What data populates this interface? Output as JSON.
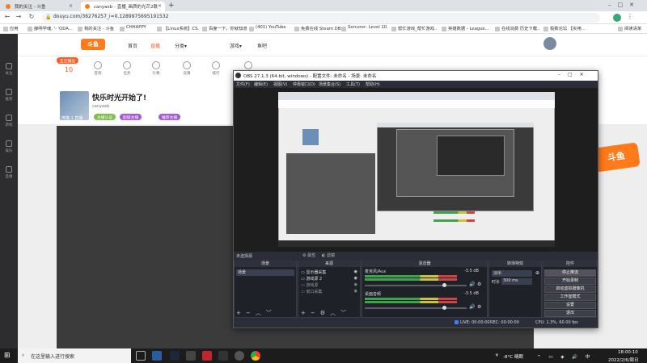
{
  "browser": {
    "tabs": [
      {
        "title": "我的关注 - 斗鱼",
        "active": false
      },
      {
        "title": "canyaxb - 直播_画质的光芒2联",
        "active": true
      }
    ],
    "new_tab": "+",
    "url": "douyu.com/36276257_i=0.1289975695191532",
    "bookmarks": [
      "应用",
      "薛明学魂, '- 'ODA...",
      "我的关注 - 斗鱼",
      "CHHAPPY",
      "【Linux系统】CS...",
      "百度一下，你就知道",
      "(401) YouTube",
      "免费在线 Steam DB",
      "Sorcerer: Level 10...",
      "帮忙游戏_帮忙游戏...",
      "英雄数据 - League...",
      "在线消费 历史下载...",
      "极致论坛 【实用...",
      "阅读清单"
    ]
  },
  "douyu": {
    "sidebar": [
      "关注",
      "推荐",
      "游戏",
      "娱乐",
      "直播"
    ],
    "logo": "斗鱼",
    "nav": [
      "首页",
      "直播",
      "分类▾",
      "游戏▾",
      "鱼吧"
    ],
    "tools": [
      "10",
      "签到",
      "任务",
      "礼物",
      "竞猜",
      "排行",
      "粉丝",
      "活动",
      "鱼塘",
      "互动"
    ],
    "tool_badge": "正在播出",
    "stream_title": "快乐时光开始了!",
    "streamer_meta": "canyaxb",
    "streamer_label": "熊猫·1 直播",
    "tag1": "主播认证",
    "tag2": "超级主播",
    "tag3": "推荐主播"
  },
  "obs": {
    "title": "OBS 27.1.3 (64-bit, windows) - 配置文件: 未命名 - 场景: 未命名",
    "menu": [
      "文件(F)",
      "编辑(E)",
      "视图(V)",
      "停靠窗口(D)",
      "场景集合(S)",
      "工具(T)",
      "帮助(H)"
    ],
    "no_source": "未选择源",
    "prop_btn": "属性",
    "filter_btn": "滤镜",
    "docks": {
      "scenes": "场景",
      "sources": "来源",
      "mixer": "混音器",
      "transitions": "转场特效",
      "controls": "控件"
    },
    "scene_items": [
      "场景"
    ],
    "source_items": [
      "显示器采集",
      "游戏源 2",
      "游戏源",
      "窗口采集"
    ],
    "mixer": [
      {
        "name": "麦克风/Aux",
        "db": "-3.5 dB",
        "level": 0.78
      },
      {
        "name": "桌面音频",
        "db": "-3.5 dB",
        "level": 0.78
      }
    ],
    "transition": {
      "type": "淡出",
      "duration_label": "时长",
      "duration": "300 ms"
    },
    "controls": [
      "停止推流",
      "开始录制",
      "启动虚拟摄像机",
      "工作室模式",
      "设置",
      "退出"
    ],
    "status": {
      "live": "LIVE: 00:00:00",
      "rec": "REC: 00:00:00",
      "cpu": "CPU: 1.3%, 60.00 fps"
    }
  },
  "taskbar": {
    "search": "在这里输入进行搜索",
    "weather": "-8°C 晴朗",
    "time": "18:00:10",
    "date": "2022/2/6/周日"
  }
}
